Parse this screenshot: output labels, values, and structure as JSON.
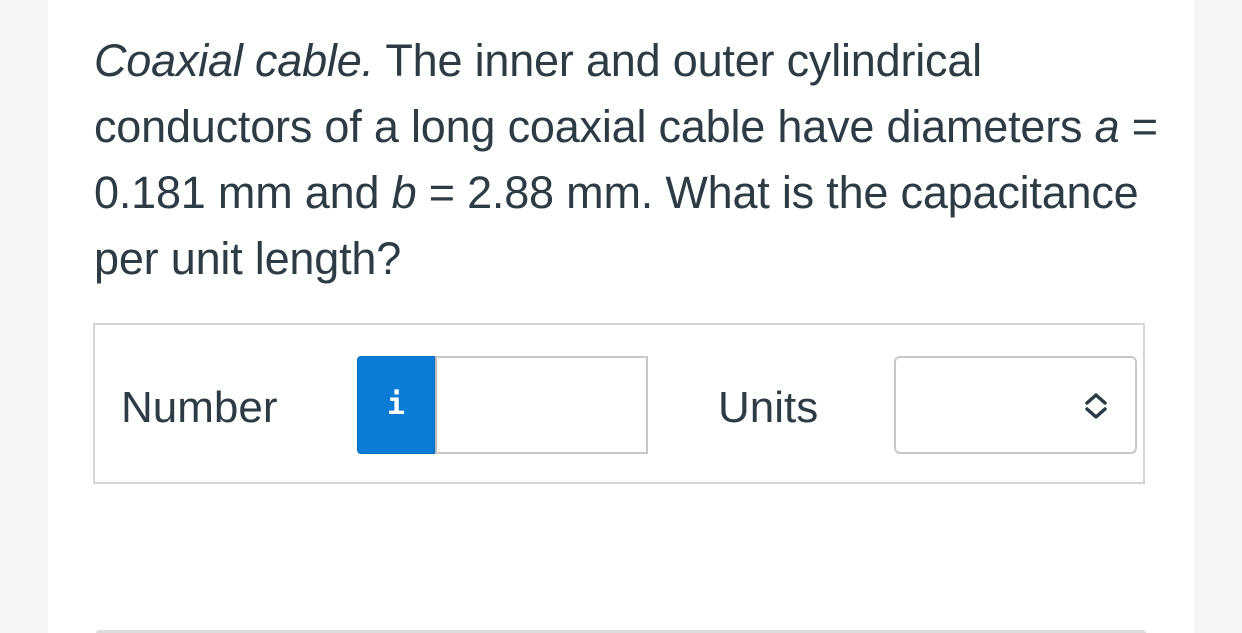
{
  "question": {
    "title": "Coaxial cable.",
    "text_part1": " The inner and outer cylindrical conductors of a long coaxial cable have diameters ",
    "var_a": "a",
    "text_part2": " = 0.181 mm and ",
    "var_b": "b",
    "text_part3": " = 2.88 mm. What is the capacitance per unit length?"
  },
  "answer": {
    "number_label": "Number",
    "info_glyph": "i",
    "number_value": "",
    "units_label": "Units",
    "units_value": ""
  },
  "colors": {
    "info_button": "#0a7cd6",
    "text": "#2d3b45"
  },
  "icons": {
    "info": "info-icon",
    "units_dropdown": "up-down-chevron-icon"
  }
}
